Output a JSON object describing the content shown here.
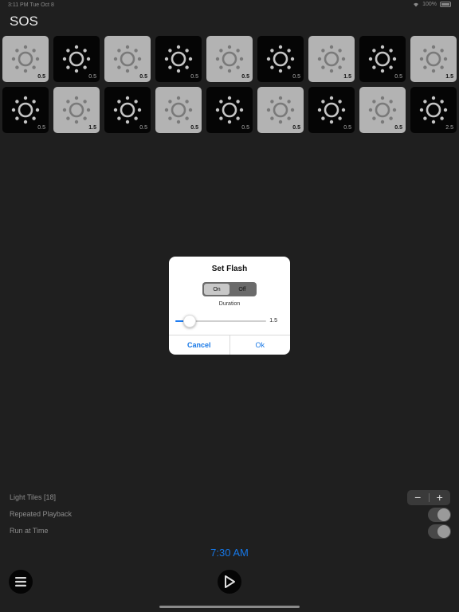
{
  "status_bar": {
    "time": "3:11 PM  Tue Oct 8",
    "battery": "100%"
  },
  "app": {
    "title": "SOS"
  },
  "tiles": [
    {
      "state": "on",
      "duration": "0.5"
    },
    {
      "state": "off",
      "duration": "0.5"
    },
    {
      "state": "on",
      "duration": "0.5"
    },
    {
      "state": "off",
      "duration": "0.5"
    },
    {
      "state": "on",
      "duration": "0.5"
    },
    {
      "state": "off",
      "duration": "0.5"
    },
    {
      "state": "on",
      "duration": "1.5"
    },
    {
      "state": "off",
      "duration": "0.5"
    },
    {
      "state": "on",
      "duration": "1.5"
    },
    {
      "state": "off",
      "duration": "0.5"
    },
    {
      "state": "on",
      "duration": "1.5"
    },
    {
      "state": "off",
      "duration": "0.5"
    },
    {
      "state": "on",
      "duration": "0.5"
    },
    {
      "state": "off",
      "duration": "0.5"
    },
    {
      "state": "on",
      "duration": "0.5"
    },
    {
      "state": "off",
      "duration": "0.5"
    },
    {
      "state": "on",
      "duration": "0.5"
    },
    {
      "state": "off",
      "duration": "2.5"
    }
  ],
  "dialog": {
    "title": "Set Flash",
    "segment": {
      "on_label": "On",
      "off_label": "Off",
      "selected": "On"
    },
    "duration_label": "Duration",
    "duration_value": "1.5",
    "slider_fraction": 0.1,
    "cancel_label": "Cancel",
    "ok_label": "Ok"
  },
  "settings": {
    "light_tiles_label": "Light Tiles [18]",
    "stepper_minus": "−",
    "stepper_plus": "+",
    "repeated_playback_label": "Repeated Playback",
    "repeated_playback_on": false,
    "run_at_time_label": "Run at Time",
    "run_at_time_on": false
  },
  "schedule": {
    "time": "7:30 AM"
  },
  "colors": {
    "accent": "#1677e6",
    "background": "#1f1f1f",
    "tile_on": "#b3b3b3",
    "tile_off": "#050505"
  },
  "icons": {
    "tile": "light-burst-icon",
    "menu": "menu-icon",
    "play": "play-icon"
  }
}
